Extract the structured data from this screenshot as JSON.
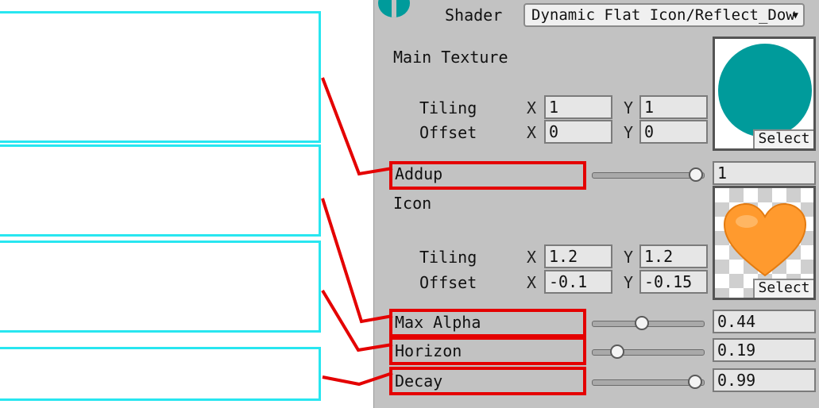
{
  "colors": {
    "accent_cyan": "#28e6f0",
    "highlight_red": "#e40000",
    "panel_gray": "#c2c2c2",
    "main_texture_teal": "#009b9b",
    "icon_orange": "#ff9a2e"
  },
  "header": {
    "shader_label": "Shader",
    "shader_value": "Dynamic Flat Icon/Reflect_Dow",
    "dropdown_icon": "chevron-down-icon"
  },
  "main_texture": {
    "label": "Main Texture",
    "tiling_label": "Tiling",
    "offset_label": "Offset",
    "x_label": "X",
    "y_label": "Y",
    "tiling_x": "1",
    "tiling_y": "1",
    "offset_x": "0",
    "offset_y": "0",
    "select_label": "Select"
  },
  "addup": {
    "label": "Addup",
    "value": "1",
    "fraction": 1.0
  },
  "icon": {
    "label": "Icon",
    "tiling_label": "Tiling",
    "offset_label": "Offset",
    "x_label": "X",
    "y_label": "Y",
    "tiling_x": "1.2",
    "tiling_y": "1.2",
    "offset_x": "-0.1",
    "offset_y": "-0.15",
    "select_label": "Select"
  },
  "max_alpha": {
    "label": "Max Alpha",
    "value": "0.44",
    "fraction": 0.44
  },
  "horizon": {
    "label": "Horizon",
    "value": "0.19",
    "fraction": 0.19
  },
  "decay": {
    "label": "Decay",
    "value": "0.99",
    "fraction": 0.99
  }
}
